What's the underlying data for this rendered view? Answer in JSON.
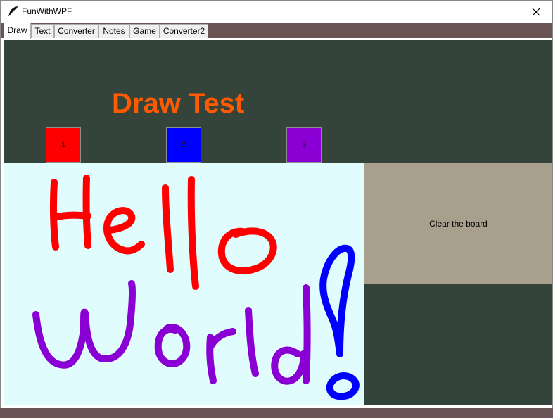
{
  "window": {
    "title": "FunWithWPF"
  },
  "tabs": [
    {
      "label": "Draw",
      "active": true
    },
    {
      "label": "Text",
      "active": false
    },
    {
      "label": "Converter",
      "active": false
    },
    {
      "label": "Notes",
      "active": false
    },
    {
      "label": "Game",
      "active": false
    },
    {
      "label": "Converter2",
      "active": false
    }
  ],
  "draw": {
    "heading": "Draw Test",
    "heading_color": "#ff5a00",
    "color_buttons": [
      {
        "label": "1",
        "color": "#ff0000"
      },
      {
        "label": "2",
        "color": "#0000ff"
      },
      {
        "label": "3",
        "color": "#8a00d4"
      }
    ],
    "canvas_background": "#e0fcfc",
    "canvas_strokes": [
      "Hello",
      "World",
      "!"
    ],
    "clear_button_label": "Clear the board"
  },
  "icons": {
    "app": "feather-icon",
    "close": "close-icon"
  }
}
